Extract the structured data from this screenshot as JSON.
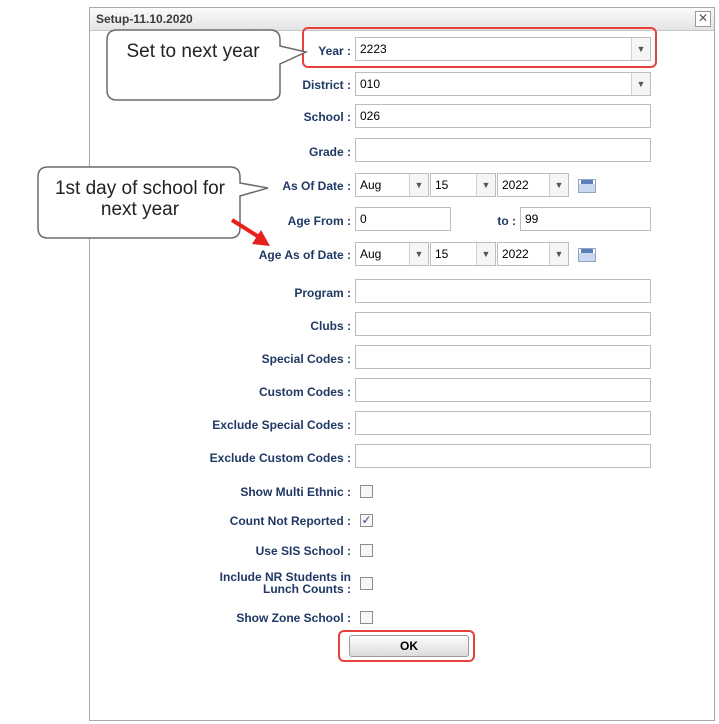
{
  "dialog": {
    "title": "Setup-11.10.2020",
    "close": "✕"
  },
  "fields": {
    "year": {
      "label": "Year :",
      "value": "2223"
    },
    "district": {
      "label": "District :",
      "value": "010"
    },
    "school": {
      "label": "School :",
      "value": "026"
    },
    "grade": {
      "label": "Grade :",
      "value": ""
    },
    "as_of_date": {
      "label": "As Of Date :",
      "month": "Aug",
      "day": "15",
      "year": "2022"
    },
    "age_from": {
      "label": "Age From :",
      "value": "0",
      "to_label": "to :",
      "to_value": "99"
    },
    "age_as_of_date": {
      "label": "Age As of Date :",
      "month": "Aug",
      "day": "15",
      "year": "2022"
    },
    "program": {
      "label": "Program :",
      "value": ""
    },
    "clubs": {
      "label": "Clubs :",
      "value": ""
    },
    "special_codes": {
      "label": "Special Codes :",
      "value": ""
    },
    "custom_codes": {
      "label": "Custom Codes :",
      "value": ""
    },
    "exclude_special_codes": {
      "label": "Exclude Special Codes :",
      "value": ""
    },
    "exclude_custom_codes": {
      "label": "Exclude Custom Codes :",
      "value": ""
    }
  },
  "checkboxes": {
    "show_multi_ethnic": {
      "label": "Show Multi Ethnic :",
      "checked": false,
      "mark": ""
    },
    "count_not_reported": {
      "label": "Count Not Reported :",
      "checked": true,
      "mark": "✓"
    },
    "use_sis_school": {
      "label": "Use SIS School :",
      "checked": false,
      "mark": ""
    },
    "include_nr_students": {
      "label": "Include NR Students in Lunch Counts :",
      "checked": false,
      "mark": ""
    },
    "show_zone_school": {
      "label": "Show Zone School :",
      "checked": false,
      "mark": ""
    }
  },
  "ok_button": {
    "label": "OK"
  },
  "callouts": {
    "year": "Set to next year",
    "date": "1st day of school for next year"
  },
  "colors": {
    "highlight": "#e8413c",
    "label": "#1f3864",
    "arrow": "#e8201b"
  }
}
